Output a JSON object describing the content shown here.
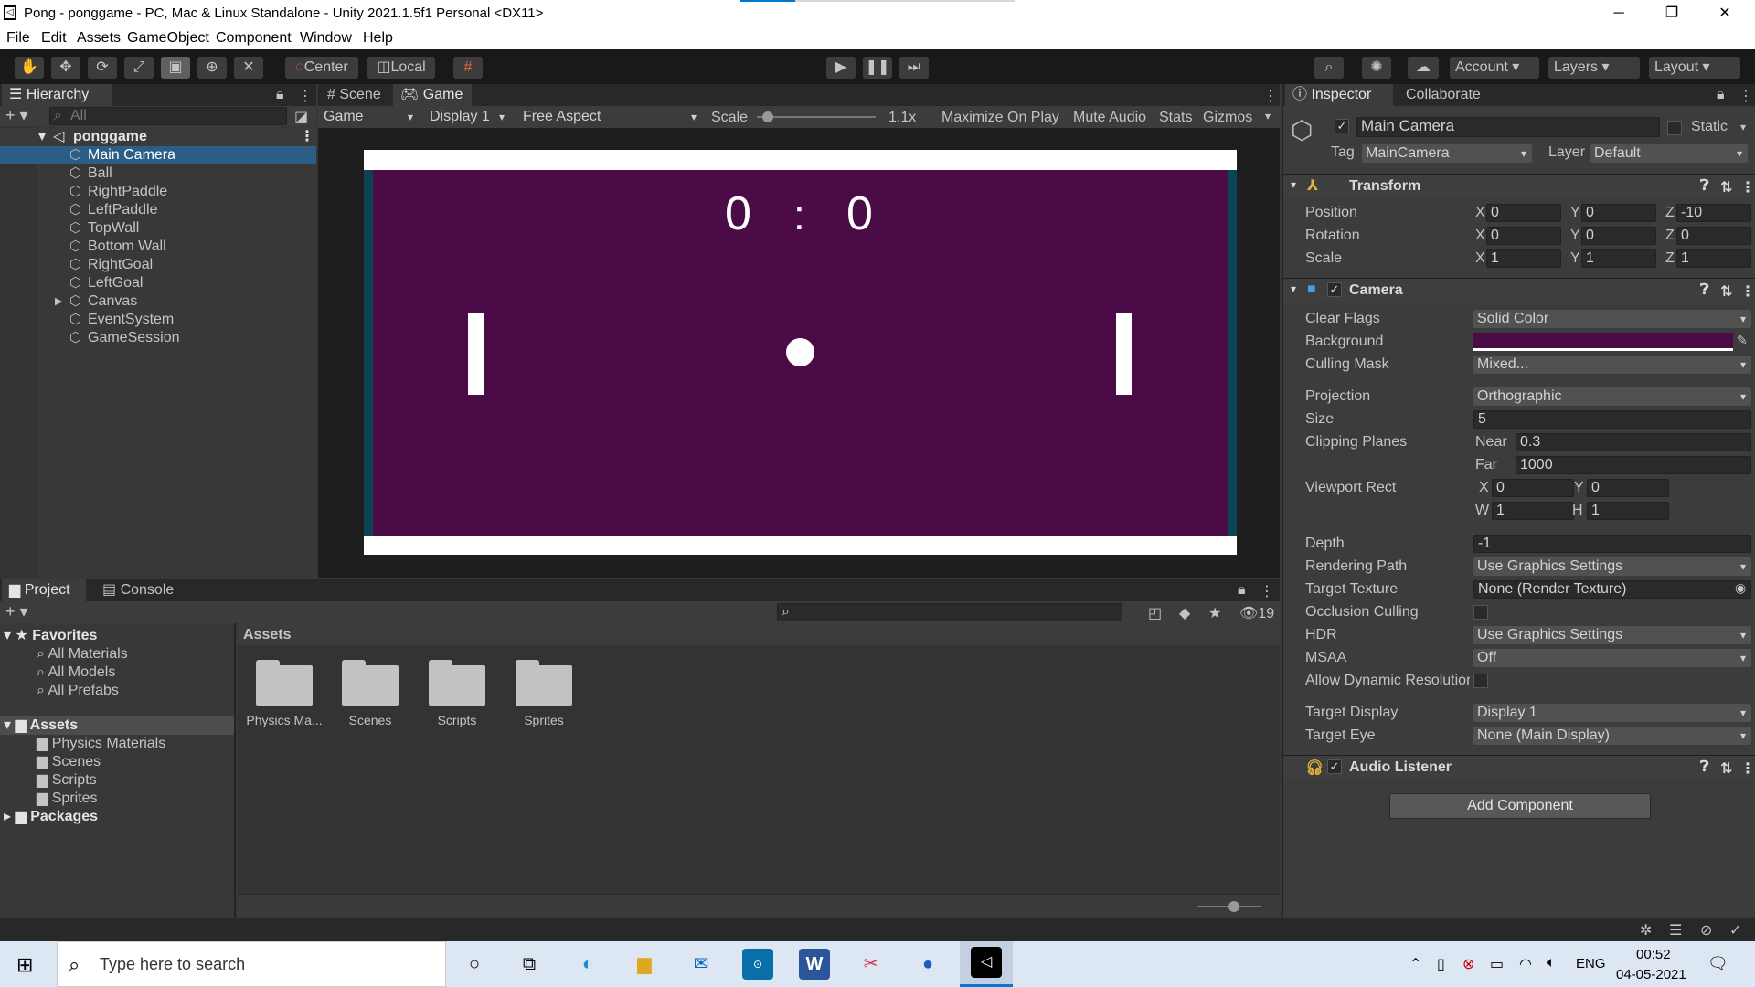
{
  "window": {
    "title": "Pong - ponggame - PC, Mac & Linux Standalone - Unity 2021.1.5f1 Personal <DX11>",
    "minimize": "─",
    "maximize": "❐",
    "close": "✕"
  },
  "menu": [
    "File",
    "Edit",
    "Assets",
    "GameObject",
    "Component",
    "Window",
    "Help"
  ],
  "toolbar": {
    "center": "Center",
    "local": "Local",
    "account": "Account",
    "layers": "Layers",
    "layout": "Layout"
  },
  "hierarchy": {
    "tab": "Hierarchy",
    "search_placeholder": "All",
    "scene": "ponggame",
    "items": [
      "Main Camera",
      "Ball",
      "RightPaddle",
      "LeftPaddle",
      "TopWall",
      "Bottom Wall",
      "RightGoal",
      "LeftGoal",
      "Canvas",
      "EventSystem",
      "GameSession"
    ],
    "selected": "Main Camera"
  },
  "game_view": {
    "tabs": [
      "Scene",
      "Game"
    ],
    "view_mode": "Game",
    "display": "Display 1",
    "aspect": "Free Aspect",
    "scale_label": "Scale",
    "scale_value": "1.1x",
    "buttons": [
      "Maximize On Play",
      "Mute Audio",
      "Stats",
      "Gizmos"
    ],
    "score_left": "0",
    "score_sep": ":",
    "score_right": "0",
    "background_color": "#4a0b47"
  },
  "project": {
    "tabs": [
      "Project",
      "Console"
    ],
    "favorites_label": "Favorites",
    "favorites": [
      "All Materials",
      "All Models",
      "All Prefabs"
    ],
    "assets_label": "Assets",
    "assets_folders": [
      "Physics Materials",
      "Scenes",
      "Scripts",
      "Sprites"
    ],
    "packages_label": "Packages",
    "breadcrumb": "Assets",
    "grid_items": [
      "Physics Ma...",
      "Scenes",
      "Scripts",
      "Sprites"
    ],
    "hidden_count": "19"
  },
  "inspector": {
    "tabs": [
      "Inspector",
      "Collaborate"
    ],
    "object_name": "Main Camera",
    "static_label": "Static",
    "tag_label": "Tag",
    "tag_value": "MainCamera",
    "layer_label": "Layer",
    "layer_value": "Default",
    "transform": {
      "title": "Transform",
      "position": {
        "label": "Position",
        "x": "0",
        "y": "0",
        "z": "-10"
      },
      "rotation": {
        "label": "Rotation",
        "x": "0",
        "y": "0",
        "z": "0"
      },
      "scale": {
        "label": "Scale",
        "x": "1",
        "y": "1",
        "z": "1"
      }
    },
    "camera": {
      "title": "Camera",
      "clear_flags": {
        "label": "Clear Flags",
        "value": "Solid Color"
      },
      "background": {
        "label": "Background",
        "color": "#4a0b47"
      },
      "culling_mask": {
        "label": "Culling Mask",
        "value": "Mixed..."
      },
      "projection": {
        "label": "Projection",
        "value": "Orthographic"
      },
      "size": {
        "label": "Size",
        "value": "5"
      },
      "clipping": {
        "label": "Clipping Planes",
        "near_label": "Near",
        "near": "0.3",
        "far_label": "Far",
        "far": "1000"
      },
      "viewport": {
        "label": "Viewport Rect",
        "x": "0",
        "y": "0",
        "w": "1",
        "h": "1"
      },
      "depth": {
        "label": "Depth",
        "value": "-1"
      },
      "rendering_path": {
        "label": "Rendering Path",
        "value": "Use Graphics Settings"
      },
      "target_texture": {
        "label": "Target Texture",
        "value": "None (Render Texture)"
      },
      "occlusion": {
        "label": "Occlusion Culling"
      },
      "hdr": {
        "label": "HDR",
        "value": "Use Graphics Settings"
      },
      "msaa": {
        "label": "MSAA",
        "value": "Off"
      },
      "dynamic_res": {
        "label": "Allow Dynamic Resolutior"
      },
      "target_display": {
        "label": "Target Display",
        "value": "Display 1"
      },
      "target_eye": {
        "label": "Target Eye",
        "value": "None (Main Display)"
      }
    },
    "audio_listener": {
      "title": "Audio Listener"
    },
    "add_component": "Add Component"
  },
  "taskbar": {
    "search_placeholder": "Type here to search",
    "lang": "ENG",
    "time": "00:52",
    "date": "04-05-2021"
  }
}
